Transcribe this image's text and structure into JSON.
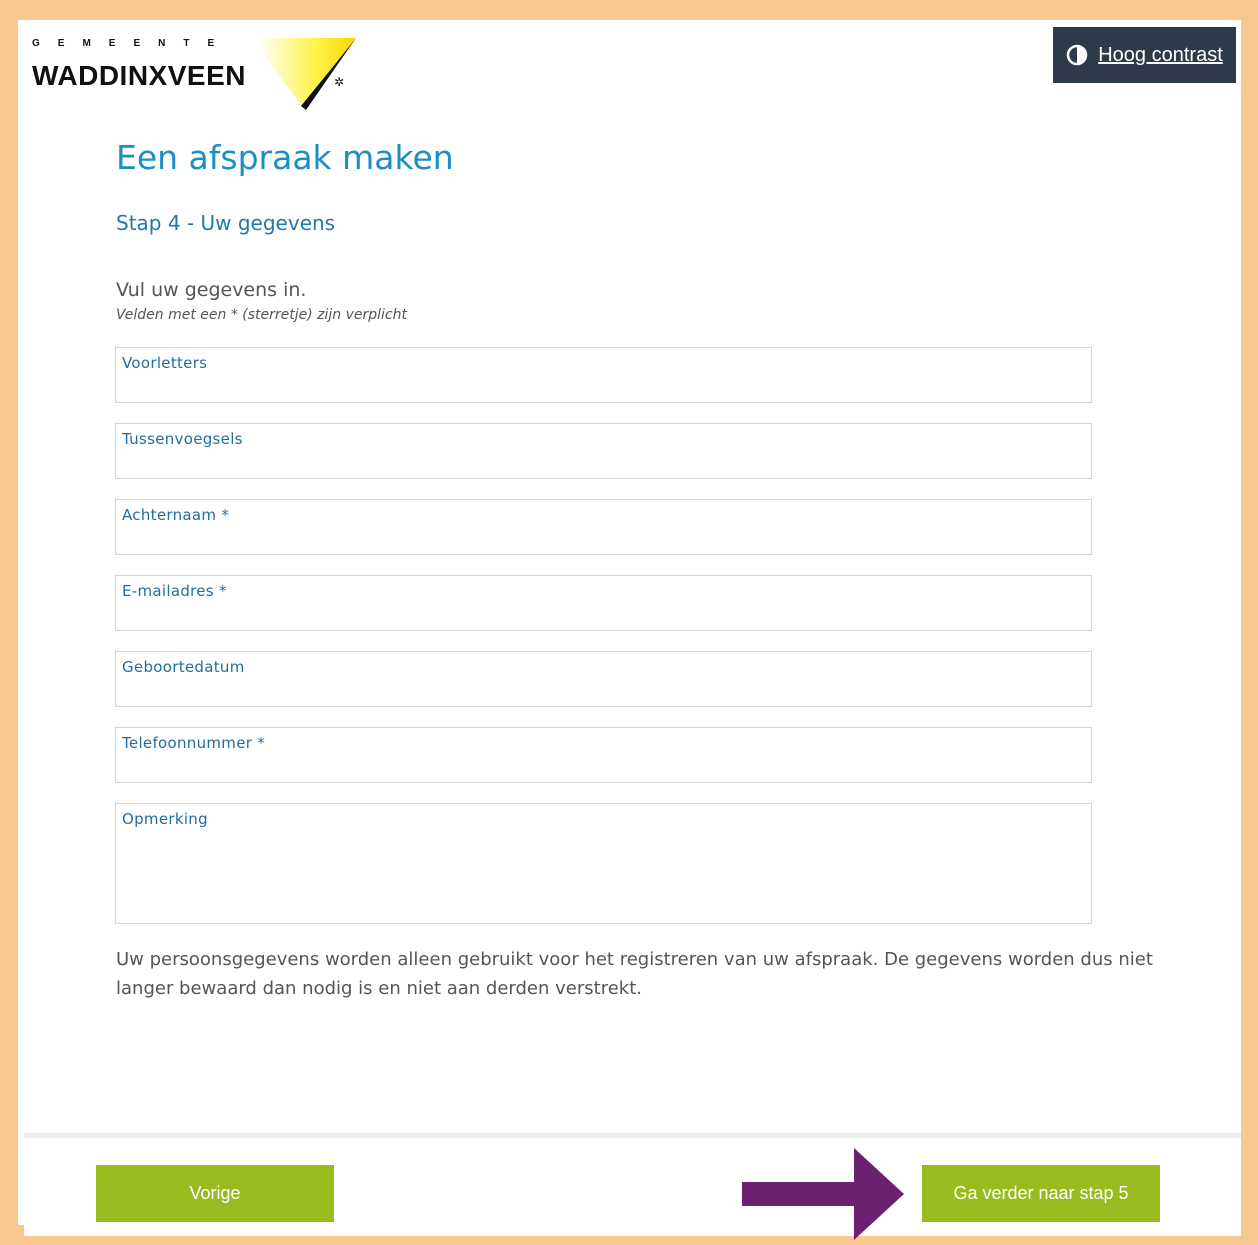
{
  "header": {
    "logo_top": "GEMEENTE",
    "logo_main": "WADDINXVEEN",
    "contrast_label": "Hoog contrast"
  },
  "page": {
    "title": "Een afspraak maken",
    "step": "Stap 4 - Uw gegevens",
    "intro": "Vul uw gegevens in.",
    "required_note": "Velden met een * (sterretje) zijn verplicht"
  },
  "form": {
    "voorletters": {
      "label": "Voorletters",
      "value": ""
    },
    "tussenvoegsels": {
      "label": "Tussenvoegsels",
      "value": ""
    },
    "achternaam": {
      "label": "Achternaam *",
      "value": ""
    },
    "email": {
      "label": "E-mailadres *",
      "value": ""
    },
    "geboortedatum": {
      "label": "Geboortedatum",
      "value": ""
    },
    "telefoon": {
      "label": "Telefoonnummer *",
      "value": ""
    },
    "opmerking": {
      "label": "Opmerking",
      "value": ""
    }
  },
  "privacy_text": "Uw persoonsgegevens worden alleen gebruikt voor het registreren van uw afspraak. De gegevens worden dus niet langer bewaard dan nodig is en niet aan derden verstrekt.",
  "footer": {
    "prev_label": "Vorige",
    "next_label": "Ga verder naar stap 5"
  },
  "colors": {
    "frame": "#f7c88f",
    "accent_blue": "#1a8fc4",
    "button_green": "#99bb1f",
    "contrast_bg": "#2e3a49",
    "arrow_purple": "#6b2370"
  }
}
